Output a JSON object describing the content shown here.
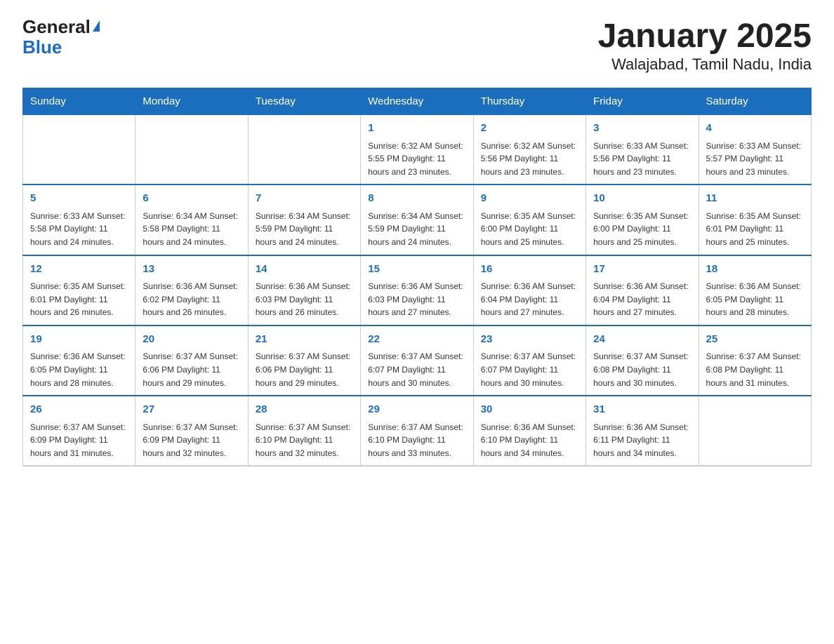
{
  "logo": {
    "line1": "General",
    "triangle": "▶",
    "line2": "Blue"
  },
  "title": "January 2025",
  "subtitle": "Walajabad, Tamil Nadu, India",
  "days": [
    "Sunday",
    "Monday",
    "Tuesday",
    "Wednesday",
    "Thursday",
    "Friday",
    "Saturday"
  ],
  "weeks": [
    [
      {
        "day": "",
        "info": ""
      },
      {
        "day": "",
        "info": ""
      },
      {
        "day": "",
        "info": ""
      },
      {
        "day": "1",
        "info": "Sunrise: 6:32 AM\nSunset: 5:55 PM\nDaylight: 11 hours and 23 minutes."
      },
      {
        "day": "2",
        "info": "Sunrise: 6:32 AM\nSunset: 5:56 PM\nDaylight: 11 hours and 23 minutes."
      },
      {
        "day": "3",
        "info": "Sunrise: 6:33 AM\nSunset: 5:56 PM\nDaylight: 11 hours and 23 minutes."
      },
      {
        "day": "4",
        "info": "Sunrise: 6:33 AM\nSunset: 5:57 PM\nDaylight: 11 hours and 23 minutes."
      }
    ],
    [
      {
        "day": "5",
        "info": "Sunrise: 6:33 AM\nSunset: 5:58 PM\nDaylight: 11 hours and 24 minutes."
      },
      {
        "day": "6",
        "info": "Sunrise: 6:34 AM\nSunset: 5:58 PM\nDaylight: 11 hours and 24 minutes."
      },
      {
        "day": "7",
        "info": "Sunrise: 6:34 AM\nSunset: 5:59 PM\nDaylight: 11 hours and 24 minutes."
      },
      {
        "day": "8",
        "info": "Sunrise: 6:34 AM\nSunset: 5:59 PM\nDaylight: 11 hours and 24 minutes."
      },
      {
        "day": "9",
        "info": "Sunrise: 6:35 AM\nSunset: 6:00 PM\nDaylight: 11 hours and 25 minutes."
      },
      {
        "day": "10",
        "info": "Sunrise: 6:35 AM\nSunset: 6:00 PM\nDaylight: 11 hours and 25 minutes."
      },
      {
        "day": "11",
        "info": "Sunrise: 6:35 AM\nSunset: 6:01 PM\nDaylight: 11 hours and 25 minutes."
      }
    ],
    [
      {
        "day": "12",
        "info": "Sunrise: 6:35 AM\nSunset: 6:01 PM\nDaylight: 11 hours and 26 minutes."
      },
      {
        "day": "13",
        "info": "Sunrise: 6:36 AM\nSunset: 6:02 PM\nDaylight: 11 hours and 26 minutes."
      },
      {
        "day": "14",
        "info": "Sunrise: 6:36 AM\nSunset: 6:03 PM\nDaylight: 11 hours and 26 minutes."
      },
      {
        "day": "15",
        "info": "Sunrise: 6:36 AM\nSunset: 6:03 PM\nDaylight: 11 hours and 27 minutes."
      },
      {
        "day": "16",
        "info": "Sunrise: 6:36 AM\nSunset: 6:04 PM\nDaylight: 11 hours and 27 minutes."
      },
      {
        "day": "17",
        "info": "Sunrise: 6:36 AM\nSunset: 6:04 PM\nDaylight: 11 hours and 27 minutes."
      },
      {
        "day": "18",
        "info": "Sunrise: 6:36 AM\nSunset: 6:05 PM\nDaylight: 11 hours and 28 minutes."
      }
    ],
    [
      {
        "day": "19",
        "info": "Sunrise: 6:36 AM\nSunset: 6:05 PM\nDaylight: 11 hours and 28 minutes."
      },
      {
        "day": "20",
        "info": "Sunrise: 6:37 AM\nSunset: 6:06 PM\nDaylight: 11 hours and 29 minutes."
      },
      {
        "day": "21",
        "info": "Sunrise: 6:37 AM\nSunset: 6:06 PM\nDaylight: 11 hours and 29 minutes."
      },
      {
        "day": "22",
        "info": "Sunrise: 6:37 AM\nSunset: 6:07 PM\nDaylight: 11 hours and 30 minutes."
      },
      {
        "day": "23",
        "info": "Sunrise: 6:37 AM\nSunset: 6:07 PM\nDaylight: 11 hours and 30 minutes."
      },
      {
        "day": "24",
        "info": "Sunrise: 6:37 AM\nSunset: 6:08 PM\nDaylight: 11 hours and 30 minutes."
      },
      {
        "day": "25",
        "info": "Sunrise: 6:37 AM\nSunset: 6:08 PM\nDaylight: 11 hours and 31 minutes."
      }
    ],
    [
      {
        "day": "26",
        "info": "Sunrise: 6:37 AM\nSunset: 6:09 PM\nDaylight: 11 hours and 31 minutes."
      },
      {
        "day": "27",
        "info": "Sunrise: 6:37 AM\nSunset: 6:09 PM\nDaylight: 11 hours and 32 minutes."
      },
      {
        "day": "28",
        "info": "Sunrise: 6:37 AM\nSunset: 6:10 PM\nDaylight: 11 hours and 32 minutes."
      },
      {
        "day": "29",
        "info": "Sunrise: 6:37 AM\nSunset: 6:10 PM\nDaylight: 11 hours and 33 minutes."
      },
      {
        "day": "30",
        "info": "Sunrise: 6:36 AM\nSunset: 6:10 PM\nDaylight: 11 hours and 34 minutes."
      },
      {
        "day": "31",
        "info": "Sunrise: 6:36 AM\nSunset: 6:11 PM\nDaylight: 11 hours and 34 minutes."
      },
      {
        "day": "",
        "info": ""
      }
    ]
  ]
}
